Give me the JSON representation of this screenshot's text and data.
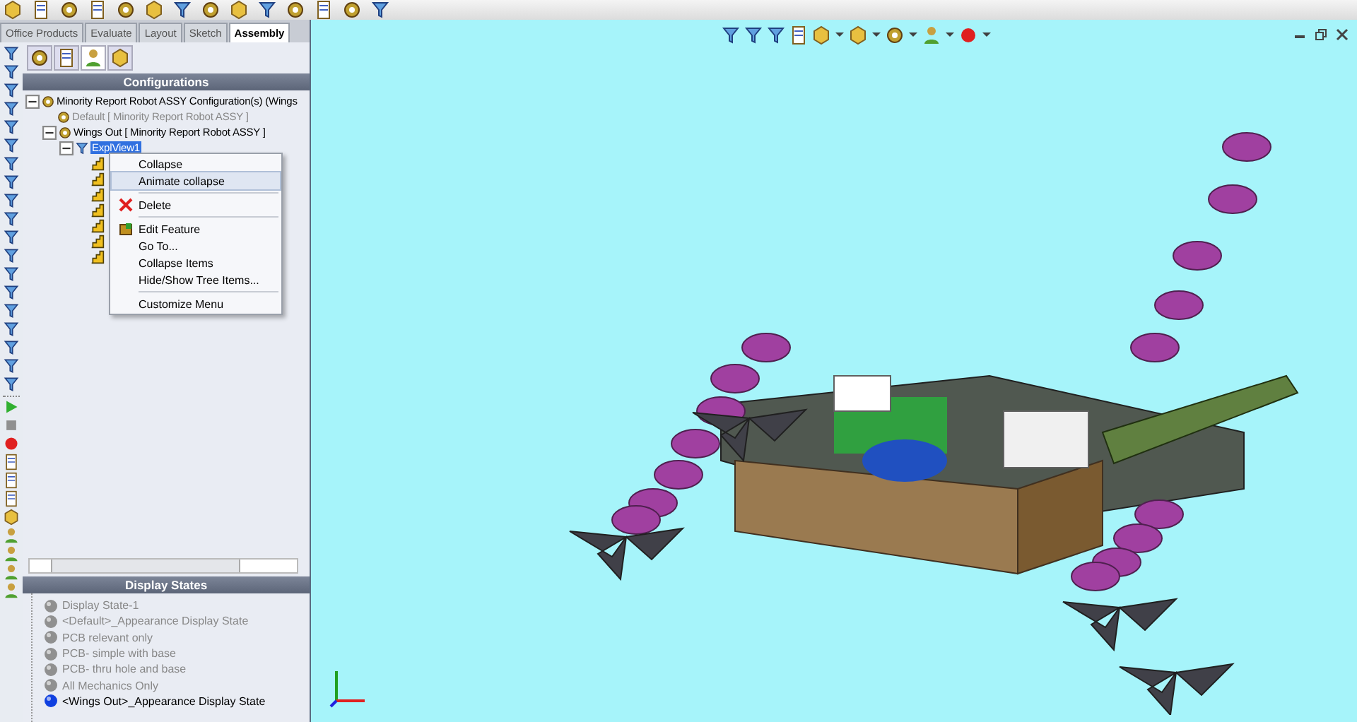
{
  "tabs": [
    {
      "label": "Office Products",
      "selected": false
    },
    {
      "label": "Evaluate",
      "selected": false
    },
    {
      "label": "Layout",
      "selected": false
    },
    {
      "label": "Sketch",
      "selected": false
    },
    {
      "label": "Assembly",
      "selected": true
    }
  ],
  "configurations": {
    "title": "Configurations",
    "tree": [
      {
        "label": "Minority Report Robot ASSY Configuration(s)  (Wings",
        "kind": "root",
        "active": true,
        "expanded": true,
        "selected": false,
        "children": [
          {
            "label": "Default [ Minority Report Robot ASSY ]",
            "kind": "config",
            "active": false,
            "selected": false
          },
          {
            "label": "Wings Out [ Minority Report Robot ASSY ]",
            "kind": "config",
            "active": true,
            "expanded": true,
            "selected": false,
            "children": [
              {
                "label": "ExplView1",
                "kind": "explode",
                "active": true,
                "expanded": true,
                "selected": true,
                "children": [
                  {
                    "kind": "step"
                  },
                  {
                    "kind": "step"
                  },
                  {
                    "kind": "step"
                  },
                  {
                    "kind": "step"
                  },
                  {
                    "kind": "step"
                  },
                  {
                    "kind": "step"
                  },
                  {
                    "kind": "step"
                  }
                ]
              }
            ]
          }
        ]
      }
    ]
  },
  "context_menu": [
    {
      "kind": "plain",
      "label": "Collapse",
      "hovered": false
    },
    {
      "kind": "plain",
      "label": "Animate collapse",
      "hovered": true
    },
    {
      "kind": "separator"
    },
    {
      "kind": "delete",
      "label": "Delete",
      "hovered": false
    },
    {
      "kind": "separator"
    },
    {
      "kind": "edit",
      "label": "Edit Feature",
      "hovered": false
    },
    {
      "kind": "plain",
      "label": "Go To...",
      "hovered": false
    },
    {
      "kind": "plain",
      "label": "Collapse Items",
      "hovered": false
    },
    {
      "kind": "plain",
      "label": "Hide/Show Tree Items...",
      "hovered": false
    },
    {
      "kind": "separator"
    },
    {
      "kind": "plain",
      "label": "Customize Menu",
      "hovered": false
    }
  ],
  "display_states": {
    "title": "Display States",
    "items": [
      {
        "label": "Display State-1",
        "active": false
      },
      {
        "label": "<Default>_Appearance Display State",
        "active": false
      },
      {
        "label": "PCB relevant only",
        "active": false
      },
      {
        "label": "PCB- simple with base",
        "active": false
      },
      {
        "label": "PCB- thru hole and base",
        "active": false
      },
      {
        "label": "All Mechanics Only",
        "active": false
      },
      {
        "label": "<Wings Out>_Appearance Display State",
        "active": true
      }
    ]
  }
}
